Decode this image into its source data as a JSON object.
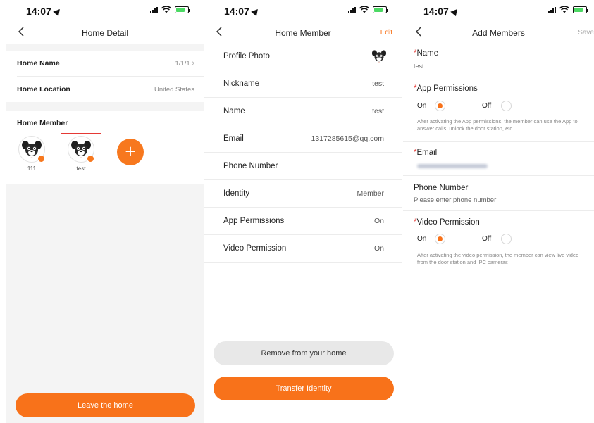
{
  "status": {
    "time": "14:07"
  },
  "home_detail": {
    "title": "Home Detail",
    "home_name_label": "Home Name",
    "home_name_value": "1/1/1",
    "home_location_label": "Home Location",
    "home_location_value": "United States",
    "members_title": "Home Member",
    "members": [
      {
        "name": "111"
      },
      {
        "name": "test"
      }
    ],
    "add_icon": "plus-icon",
    "leave_label": "Leave the home"
  },
  "home_member": {
    "title": "Home Member",
    "edit_label": "Edit",
    "rows": [
      {
        "label": "Profile Photo",
        "value": ""
      },
      {
        "label": "Nickname",
        "value": "test"
      },
      {
        "label": "Name",
        "value": "test"
      },
      {
        "label": "Email",
        "value": "1317285615@qq.com"
      },
      {
        "label": "Phone Number",
        "value": ""
      },
      {
        "label": "Identity",
        "value": "Member"
      },
      {
        "label": "App Permissions",
        "value": "On"
      },
      {
        "label": "Video Permission",
        "value": "On"
      }
    ],
    "remove_label": "Remove from your home",
    "transfer_label": "Transfer Identity"
  },
  "add_members": {
    "title": "Add Members",
    "save_label": "Save",
    "name_label": "Name",
    "name_value": "test",
    "app_perm_label": "App Permissions",
    "on_label": "On",
    "off_label": "Off",
    "app_perm_note": "After activating the App permissions, the member can use the App to answer calls, unlock the door station, etc.",
    "email_label": "Email",
    "phone_label": "Phone Number",
    "phone_placeholder": "Please enter phone number",
    "video_perm_label": "Video Permission",
    "video_perm_note": "After activating the video permission, the member can view live video from the door station and IPC cameras",
    "required_mark": "*"
  },
  "colors": {
    "accent": "#f8721a",
    "required": "#e53935",
    "selection": "#e53935"
  }
}
